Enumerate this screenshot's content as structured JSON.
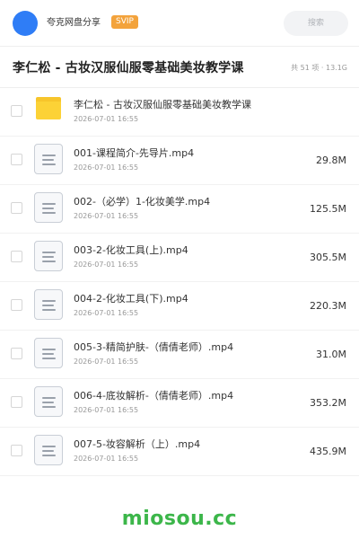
{
  "app": {
    "brand": "夸克网盘分享",
    "badge": "SVIP",
    "search_placeholder": "搜索",
    "accent_color": "#2f7df6",
    "badge_color": "#f3a33c"
  },
  "share": {
    "title": "李仁松 - 古妆汉服仙服零基础美妆教学课",
    "meta": "共 51 项 · 13.1G"
  },
  "files": [
    {
      "name": "李仁松 - 古妆汉服仙服零基础美妆教学课",
      "date": "2026-07-01 16:55",
      "size": "",
      "icon": "folder-icon"
    },
    {
      "name": "001-课程简介-先导片.mp4",
      "date": "2026-07-01 16:55",
      "size": "29.8M",
      "icon": "document-icon"
    },
    {
      "name": "002-（必学）1-化妆美学.mp4",
      "date": "2026-07-01 16:55",
      "size": "125.5M",
      "icon": "document-icon"
    },
    {
      "name": "003-2-化妆工具(上).mp4",
      "date": "2026-07-01 16:55",
      "size": "305.5M",
      "icon": "document-icon"
    },
    {
      "name": "004-2-化妆工具(下).mp4",
      "date": "2026-07-01 16:55",
      "size": "220.3M",
      "icon": "document-icon"
    },
    {
      "name": "005-3-精简护肤-（倩倩老师）.mp4",
      "date": "2026-07-01 16:55",
      "size": "31.0M",
      "icon": "document-icon"
    },
    {
      "name": "006-4-底妆解析-（倩倩老师）.mp4",
      "date": "2026-07-01 16:55",
      "size": "353.2M",
      "icon": "document-icon"
    },
    {
      "name": "007-5-妆容解析（上）.mp4",
      "date": "2026-07-01 16:55",
      "size": "435.9M",
      "icon": "document-icon"
    }
  ],
  "watermark": {
    "text": "miosou.cc",
    "color": "#3cb64a"
  }
}
